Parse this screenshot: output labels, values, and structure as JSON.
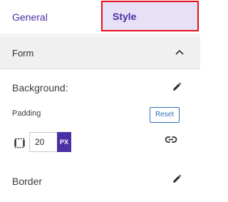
{
  "tabs": {
    "general_label": "General",
    "style_label": "Style"
  },
  "section": {
    "title": "Form",
    "state_icon": "chevron-up-icon"
  },
  "background": {
    "label": "Background:",
    "edit_icon": "pencil-icon"
  },
  "padding": {
    "label": "Padding",
    "reset_label": "Reset",
    "value": "20",
    "unit": "PX",
    "sides_icon": "box-sides-icon",
    "link_icon": "link-icon"
  },
  "border": {
    "label": "Border",
    "edit_icon": "pencil-icon"
  },
  "colors": {
    "accent": "#4b2fa4",
    "active_tab_bg": "#e7e1f8",
    "highlight": "#e5101a",
    "reset": "#2f6fbf"
  }
}
